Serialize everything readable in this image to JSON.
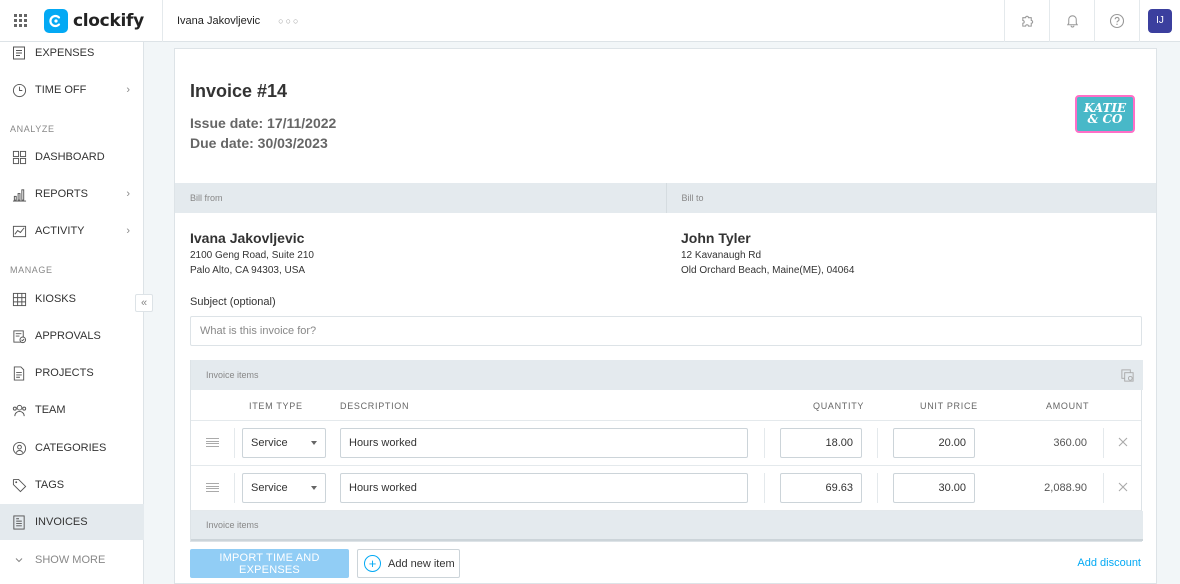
{
  "app": {
    "name": "clockify",
    "workspace": "Ivana Jakovljevic",
    "workspace_menu": "○○○",
    "user_initials": "IJ"
  },
  "colors": {
    "brand": "#03a9f4",
    "avatar": "#3b3f9e",
    "sidebar_active": "#e4eaee"
  },
  "topbar": {
    "icons": [
      "puzzle-icon",
      "bell-icon",
      "help-icon"
    ]
  },
  "sidebar": {
    "items": [
      {
        "label": "EXPENSES",
        "icon": "expenses-icon"
      },
      {
        "label": "TIME OFF",
        "icon": "clock-icon",
        "chevron": "›"
      },
      {
        "label": "DASHBOARD",
        "icon": "dashboard-icon"
      },
      {
        "label": "REPORTS",
        "icon": "reports-icon",
        "chevron": "›"
      },
      {
        "label": "ACTIVITY",
        "icon": "activity-icon",
        "chevron": "›"
      },
      {
        "label": "KIOSKS",
        "icon": "kiosk-icon"
      },
      {
        "label": "APPROVALS",
        "icon": "approvals-icon"
      },
      {
        "label": "PROJECTS",
        "icon": "projects-icon"
      },
      {
        "label": "TEAM",
        "icon": "team-icon"
      },
      {
        "label": "CATEGORIES",
        "icon": "categories-icon"
      },
      {
        "label": "TAGS",
        "icon": "tag-icon"
      },
      {
        "label": "INVOICES",
        "icon": "invoices-icon",
        "active": true
      },
      {
        "label": "SHOW MORE",
        "icon": "chevron-down-icon"
      }
    ],
    "sections": {
      "analyze": "ANALYZE",
      "manage": "MANAGE"
    },
    "collapse": "«"
  },
  "invoice": {
    "title": "Invoice #14",
    "issue_date": "Issue date: 17/11/2022",
    "due_date": "Due date: 30/03/2023",
    "logo_text_line1": "KATIE",
    "logo_text_line2": "& CO",
    "bill_from_label": "Bill from",
    "bill_to_label": "Bill to",
    "from": {
      "name": "Ivana Jakovljevic",
      "line1": "2100 Geng Road, Suite 210",
      "line2": "Palo Alto, CA 94303, USA"
    },
    "to": {
      "name": "John Tyler",
      "line1": "12 Kavanaugh Rd",
      "line2": "Old Orchard Beach, Maine(ME), 04064"
    },
    "subject_label": "Subject (optional)",
    "subject_placeholder": "What is this invoice for?",
    "subject_value": ""
  },
  "items": {
    "section_label": "Invoice items",
    "footer_label": "Invoice items",
    "columns": {
      "type": "ITEM TYPE",
      "description": "DESCRIPTION",
      "quantity": "QUANTITY",
      "unit_price": "UNIT PRICE",
      "amount": "AMOUNT"
    },
    "rows": [
      {
        "type": "Service",
        "description": "Hours worked",
        "quantity": "18.00",
        "unit_price": "20.00",
        "amount": "360.00"
      },
      {
        "type": "Service",
        "description": "Hours worked",
        "quantity": "69.63",
        "unit_price": "30.00",
        "amount": "2,088.90"
      }
    ]
  },
  "actions": {
    "import": "IMPORT TIME AND EXPENSES",
    "add_item": "Add new item",
    "add_discount": "Add discount"
  }
}
